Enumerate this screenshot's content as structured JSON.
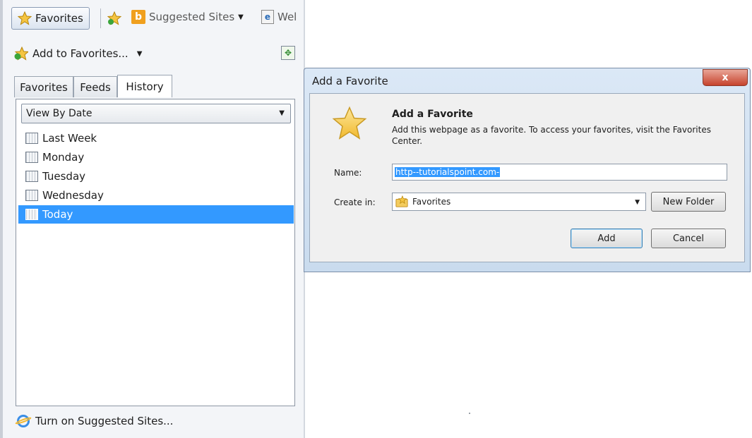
{
  "toolbar": {
    "favorites_button": "Favorites",
    "suggested_sites": "Suggested Sites",
    "web_slice": "Wel"
  },
  "panel": {
    "add_to_favorites": "Add to Favorites...",
    "tabs": [
      "Favorites",
      "Feeds",
      "History"
    ],
    "active_tab": "History",
    "view_select": "View By Date",
    "history_items": [
      "Last Week",
      "Monday",
      "Tuesday",
      "Wednesday",
      "Today"
    ],
    "selected_item": "Today",
    "bottom_link": "Turn on Suggested Sites..."
  },
  "dialog": {
    "title": "Add a Favorite",
    "close": "x",
    "heading": "Add a Favorite",
    "description": "Add this webpage as a favorite. To access your favorites, visit the Favorites Center.",
    "name_label": "Name:",
    "name_value": "http--tutorialspoint.com-",
    "create_in_label": "Create in:",
    "create_in_value": "Favorites",
    "new_folder": "New Folder",
    "add": "Add",
    "cancel": "Cancel"
  },
  "colors": {
    "selection": "#3399ff",
    "dialog_frame": "#c9dbee",
    "close_button": "#c6432c"
  }
}
